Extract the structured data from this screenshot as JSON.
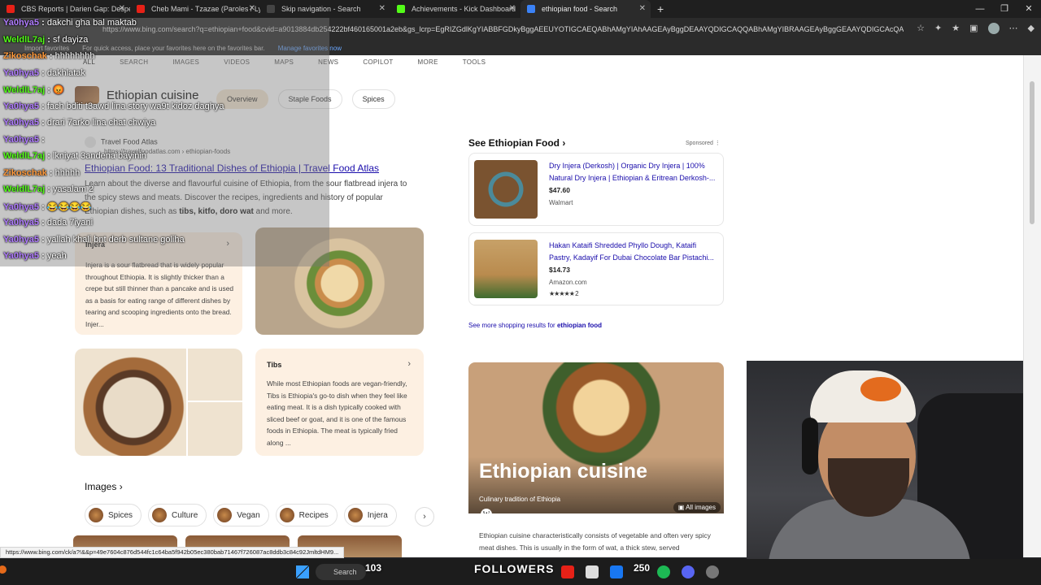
{
  "browser": {
    "tabs": [
      {
        "title": "CBS Reports | Darien Gap: Despe",
        "icon_color": "#e62117"
      },
      {
        "title": "Cheb Mami - Tzazae (Paroles / Ly",
        "icon_color": "#e62117"
      },
      {
        "title": "Skip navigation - Search",
        "icon_color": "#444444"
      },
      {
        "title": "Achievements - Kick Dashboard",
        "icon_color": "#53fc18"
      },
      {
        "title": "ethiopian food - Search",
        "icon_color": "#3b82f6"
      }
    ],
    "new_tab": "+",
    "url": "https://www.bing.com/search?q=ethiopian+food&cvid=a9013884db254222bf460165001a2eb&gs_lcrp=EgRIZGdlKgYIABBFGDkyBggAEEUYOTIGCAEQABhAMgYIAhAAGEAyBggDEAAYQDIGCAQQABhAMgYIBRAAGEAyBggGEAAYQDIGCAcQABhAMgYICBAA...",
    "favorites": {
      "import": "Import favorites",
      "tip": "For quick access, place your favorites here on the favorites bar.",
      "manage": "Manage favorites now"
    },
    "status_url": "https://www.bing.com/ck/a?!&&p=49e7604c876d544fc1c64ba5f942b05ec380bab71467f726087ac8ddb3c84c92JmltdHM9..."
  },
  "search": {
    "nav": [
      "ALL",
      "SEARCH",
      "IMAGES",
      "VIDEOS",
      "MAPS",
      "NEWS",
      "COPILOT",
      "MORE",
      "TOOLS"
    ],
    "kp_title": "Ethiopian cuisine",
    "pills": [
      "Overview",
      "Staple Foods",
      "Spices"
    ],
    "result": {
      "site": "Travel Food Atlas",
      "cite": "https://travelfoodatlas.com › ethiopian-foods",
      "title": "Ethiopian Food: 13 Traditional Dishes of Ethiopia | Travel Food Atlas",
      "snippet_1": "Learn about the diverse and flavourful cuisine of Ethiopia, from the sour flatbread injera to the spicy stews and meats. Discover the recipes, ingredients and history of popular Ethiopian dishes, such as ",
      "snippet_bold": "tibs, kitfo, doro wat",
      "snippet_2": " and more."
    },
    "injera": {
      "title": "Injera",
      "text": "Injera is a sour flatbread that is widely popular throughout Ethiopia. It is slightly thicker than a crepe but still thinner than a pancake and is used as a basis for eating range of different dishes by tearing and scooping ingredients onto the bread. Injer..."
    },
    "tibs": {
      "title": "Tibs",
      "text": "While most Ethiopian foods are vegan-friendly, Tibs is Ethiopia's go-to dish when they feel like eating meat. It is a dish typically cooked with sliced beef or goat, and it is one of the famous foods in Ethiopia. The meat is typically fried along ..."
    },
    "images_heading": "Images",
    "chips": [
      "Spices",
      "Culture",
      "Vegan",
      "Recipes",
      "Injera"
    ]
  },
  "shopping": {
    "heading": "See Ethiopian Food",
    "sponsored": "Sponsored",
    "items": [
      {
        "name": "Dry Injera (Derkosh) | Organic Dry Injera | 100% Natural Dry Injera | Ethiopian & Eritrean Derkosh-...",
        "price": "$47.60",
        "store": "Walmart",
        "rating": ""
      },
      {
        "name": "Hakan Kataifi Shredded Phyllo Dough, Kataifi Pastry, Kadayif For Dubai Chocolate Bar Pistachi...",
        "price": "$14.73",
        "store": "Amazon.com",
        "rating": "★★★★★ 2"
      }
    ],
    "see_more": "See more shopping results for ",
    "see_more_bold": "ethiopian food"
  },
  "knowledge": {
    "title": "Ethiopian cuisine",
    "subtitle": "Culinary tradition of Ethiopia",
    "all_images": "All images",
    "wiki": "W",
    "desc": "Ethiopian cuisine characteristically consists of vegetable and often very spicy meat dishes. This is usually in the form of wat, a thick stew, served"
  },
  "chat": [
    {
      "user": "Ya0hya5",
      "color": "#b07cff",
      "msg": "dakchi gha bal maktab"
    },
    {
      "user": "WeldlL7aj",
      "color": "#53fc18",
      "msg": "sf dayiza"
    },
    {
      "user": "Zikoschak",
      "color": "#ff9a3c",
      "msg": "hhhhhhhh"
    },
    {
      "user": "Ya0hya5",
      "color": "#b07cff",
      "msg": "dakhlatak"
    },
    {
      "user": "WeldlL7aj",
      "color": "#53fc18",
      "msg": "😡"
    },
    {
      "user": "Ya0hya5",
      "color": "#b07cff",
      "msg": "fach bditi t3awd lina story wa9t kidoz daghya"
    },
    {
      "user": "Ya0hya5",
      "color": "#b07cff",
      "msg": "drari 7arko lina chat chwiya"
    },
    {
      "user": "Ya0hya5",
      "color": "#b07cff",
      "msg": ""
    },
    {
      "user": "WeldlL7aj",
      "color": "#53fc18",
      "msg": "lkniyat 3andena bayinin"
    },
    {
      "user": "Zikoschak",
      "color": "#ff9a3c",
      "msg": "hhhhh"
    },
    {
      "user": "WeldlL7aj",
      "color": "#53fc18",
      "msg": "yasalam 2"
    },
    {
      "user": "Ya0hya5",
      "color": "#b07cff",
      "msg": "😂😂😂😂"
    },
    {
      "user": "Ya0hya5",
      "color": "#b07cff",
      "msg": "dada 7iyani"
    },
    {
      "user": "Ya0hya5",
      "color": "#b07cff",
      "msg": "yallah khali bnt derb sultane goliha"
    },
    {
      "user": "Ya0hya5",
      "color": "#b07cff",
      "msg": "yeah"
    }
  ],
  "taskbar": {
    "search": "Search",
    "count_left": "103",
    "followers": "FOLLOWERS",
    "count_right": "250"
  }
}
